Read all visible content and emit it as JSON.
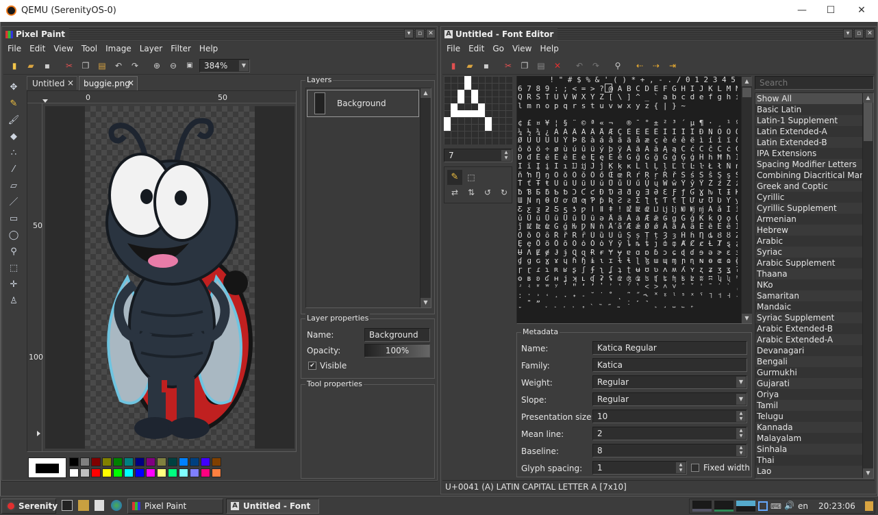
{
  "qemu": {
    "title": "QEMU (SerenityOS-0)",
    "minimize": "—",
    "maximize": "☐",
    "close": "✕"
  },
  "pixel_paint": {
    "title": "Pixel Paint",
    "menu": [
      "File",
      "Edit",
      "View",
      "Tool",
      "Image",
      "Layer",
      "Filter",
      "Help"
    ],
    "zoom": "384%",
    "tabs": [
      {
        "label": "Untitled",
        "close": "×"
      },
      {
        "label": "buggie.png",
        "close": "×"
      }
    ],
    "ruler_top": [
      "0",
      "50"
    ],
    "ruler_left": [
      "50",
      "100"
    ],
    "tool_names": [
      "move",
      "pen",
      "brush",
      "bucket",
      "spray",
      "picker",
      "erase",
      "line",
      "rect",
      "ellipse",
      "zoom",
      "rect-select",
      "guide",
      "clone"
    ],
    "tool_icons": [
      "✥",
      "✎",
      "🖌",
      "◆",
      "∴",
      "⁄",
      "▱",
      "／",
      "▭",
      "◯",
      "⚲",
      "⬚",
      "✛",
      "♙"
    ],
    "layers": {
      "title": "Layers",
      "items": [
        "Background"
      ]
    },
    "layer_properties": {
      "title": "Layer properties",
      "name_label": "Name:",
      "name_value": "Background",
      "opacity_label": "Opacity:",
      "opacity_value": "100%",
      "visible_label": "Visible",
      "visible_check": "✔"
    },
    "tool_properties": {
      "title": "Tool properties"
    },
    "palette": {
      "row1": [
        "#000000",
        "#808080",
        "#800000",
        "#808000",
        "#008000",
        "#008080",
        "#000080",
        "#800080",
        "#80803f",
        "#004040",
        "#0080ff",
        "#004080",
        "#4000ff",
        "#804000"
      ],
      "row2": [
        "#ffffff",
        "#c0c0c0",
        "#ff0000",
        "#ffff00",
        "#00ff00",
        "#00ffff",
        "#0000ff",
        "#ff00ff",
        "#ffff80",
        "#00ff80",
        "#80ffff",
        "#8080ff",
        "#ff0080",
        "#ff8040"
      ],
      "primary": "#000000",
      "secondary": "#ffffff"
    }
  },
  "font_editor": {
    "title": "Untitled - Font Editor",
    "menu": [
      "File",
      "Edit",
      "Go",
      "View",
      "Help"
    ],
    "glyph_width": "7",
    "charset_rows": [
      "       ! \" # $ % & ' ( ) * + , - . / 0 1 2 3 4 5",
      "6 7 8 9 : ; < = > ? @ A B C D E F G H I J K L M N O P",
      "Q R S T U V W X Y Z [ \\ ] ^ _ ` a b c d e f g h i j k",
      "l m n o p q r s t u v w x y z { | } ~",
      "",
      "¢ £ ¤ ¥ ¦ § ¨ © ª « ¬   ® ¯ ° ± ² ³ ´ µ ¶ · ¸ ¹ º »",
      "¼ ½ ¾ ¿ À Á Â Ã Ä Å Æ Ç È É Ê Ë Ì Í Î Ï Ð Ñ Ò Ó Ô Õ Ö ×",
      "Ø Ù Ú Û Ü Ý Þ ß à á â ã ä å æ ç è é ê ë ì í î ï ð ñ ò ó",
      "ô õ ö ÷ ø ù ú û ü ý þ ÿ Ā ā Ă ă Ą ą Ć ć Ĉ ĉ Ċ ċ Č č Ď ď",
      "Đ đ Ē ē Ĕ ĕ Ė ė Ę ę Ě ě Ĝ ĝ Ğ ğ Ġ ġ Ģ ģ Ĥ ĥ Ħ ħ Ĩ ĩ Ī ī",
      "Ĭ ĭ Į į İ ı Ĳ ĳ Ĵ ĵ Ķ ķ ĸ Ĺ ĺ Ļ ļ Ľ ľ Ŀ ŀ Ł ł Ń ń Ņ ņ Ň",
      "ň ŉ Ŋ ŋ Ō ō Ŏ ŏ Ő ő Œ œ Ŕ ŕ Ŗ ŗ Ř ř Ś ś Ŝ ŝ Ş ş Š š Ţ ţ",
      "Ť ť Ŧ ŧ Ũ ũ Ū ū Ŭ ŭ Ů ů Ű ű Ų ų Ŵ ŵ Ŷ ŷ Ÿ Ź ź Ż ż Ž ž ſ",
      "ƀ Ɓ Ƃ ƃ Ƅ ƅ Ɔ Ƈ ƈ Ɖ Ɗ Ƌ ƌ ƍ Ǝ Ə Ɛ Ƒ ƒ Ɠ Ɣ ƕ Ɩ Ɨ Ƙ ƙ ƚ ƛ",
      "Ɯ Ɲ ƞ Ɵ Ơ ơ Ƣ ƣ Ƥ ƥ Ʀ Ƨ ƨ Ʃ ƪ ƫ Ƭ ƭ Ʈ Ư ư Ʊ Ʋ Ƴ ƴ Ƶ ƶ Ʒ",
      "Ƹ ƹ ƺ ƻ Ƽ ƽ ƾ ƿ ǀ ǁ ǂ ǃ Ǆ ǅ ǆ Ǉ ǈ ǉ Ǌ ǋ ǌ Ǎ ǎ Ǐ ǐ Ǒ ǒ Ǔ",
      "ǔ Ǖ ǖ Ǘ ǘ Ǚ ǚ Ǜ ǜ ǝ Ǟ ǟ Ǡ ǡ Ǣ ǣ Ǥ ǥ Ǧ ǧ Ǩ ǩ Ǫ ǫ Ǭ ǭ Ǯ ǯ",
      "ǰ Ǳ ǲ ǳ Ǵ ǵ Ƕ Ƿ Ǹ ǹ Ǻ ǻ Ǽ ǽ Ǿ ǿ Ȁ ȁ Ȃ ȃ Ȅ ȅ Ȇ ȇ Ȉ ȉ Ȋ ȋ",
      "Ȍ ȍ Ȏ ȏ Ȑ ȑ Ȓ ȓ Ȕ ȕ Ȗ ȗ Ș ș Ț ț Ȝ ȝ Ȟ ȟ Ƞ ȡ Ȣ ȣ Ȥ ȥ Ȧ ȧ",
      "Ȩ ȩ Ȫ ȫ Ȭ ȭ Ȯ ȯ Ȱ ȱ Ȳ ȳ ȴ ȵ ȶ ȷ ȸ ȹ Ⱥ Ȼ ȼ Ƚ Ⱦ ȿ ɀ Ɂ ɂ Ƀ",
      "Ʉ Ʌ Ɇ ɇ Ɉ ɉ Ɋ ɋ Ɍ ɍ Ɏ ɏ ɐ ɑ ɒ ɓ ɔ ɕ ɖ ɗ ɘ ə ɚ ɛ ɜ ɝ ɞ ɟ",
      "ɠ ɡ ɢ ɣ ɤ ɥ ɦ ɧ ɨ ɩ ɪ ɫ ɬ ɭ ɮ ɯ ɰ ɱ ɲ ɳ ɴ ɵ ɶ ɷ ɸ ɹ ɺ ɻ",
      "ɼ ɽ ɾ ɿ ʀ ʁ ʂ ʃ ʄ ʅ ʆ ʇ ʈ ʉ ʊ ʋ ʌ ʍ ʎ ʏ ʐ ʑ ʒ ʓ ʔ ʕ ʖ ʗ",
      "ʘ ʙ ʚ ʛ ʜ ʝ ʞ ʟ ʠ ʡ ʢ ʣ ʤ ʥ ʦ ʧ ʨ ʩ ʪ ʫ ʬ ʭ ʮ ʯ ʰ ʱ ʲ ʳ",
      "ʴ ʵ ʶ ʷ ʸ ʹ ʺ ʻ ʼ ʽ ʾ ʿ ˀ ˁ ˂ ˃ ˄ ˅ ˆ ˇ ˈ ˉ ˊ ˋ ˌ ˍ ˎ ˏ",
      "ː ˑ ˒ ˓ ˔ ˕ ˖ ˗ ˘ ˙ ˚ ˛ ˜ ˝ ˞ ˟ ˠ ˡ ˢ ˣ ˤ ˥ ˦ ˧ ˨ ˩ ˪ ˫",
      "ˬ ˭ ˮ ˯ ˰ ˱ ˲ ˳ ˴ ˵ ˶ ˷ ˸ ˹ ˺ ˻ ˼ ˽ ˾ ˿",
      "",
      "",
      "˜ _ _ ~ - — ⁄ ⁄        ¸"
    ],
    "metadata": {
      "title": "Metadata",
      "name_label": "Name:",
      "name_value": "Katica Regular",
      "family_label": "Family:",
      "family_value": "Katica",
      "weight_label": "Weight:",
      "weight_value": "Regular",
      "slope_label": "Slope:",
      "slope_value": "Regular",
      "presentation_label": "Presentation size:",
      "presentation_value": "10",
      "mean_label": "Mean line:",
      "mean_value": "2",
      "baseline_label": "Baseline:",
      "baseline_value": "8",
      "spacing_label": "Glyph spacing:",
      "spacing_value": "1",
      "fixed_label": "Fixed width"
    },
    "search_placeholder": "Search",
    "blocks": [
      "Show All",
      "Basic Latin",
      "Latin-1 Supplement",
      "Latin Extended-A",
      "Latin Extended-B",
      "IPA Extensions",
      "Spacing Modifier Letters",
      "Combining Diacritical Marks",
      "Greek and Coptic",
      "Cyrillic",
      "Cyrillic Supplement",
      "Armenian",
      "Hebrew",
      "Arabic",
      "Syriac",
      "Arabic Supplement",
      "Thaana",
      "NKo",
      "Samaritan",
      "Mandaic",
      "Syriac Supplement",
      "Arabic Extended-B",
      "Arabic Extended-A",
      "Devanagari",
      "Bengali",
      "Gurmukhi",
      "Gujarati",
      "Oriya",
      "Tamil",
      "Telugu",
      "Kannada",
      "Malayalam",
      "Sinhala",
      "Thai",
      "Lao"
    ],
    "status": "U+0041 (A) LATIN CAPITAL LETTER A [7x10]"
  },
  "taskbar": {
    "start": "Serenity",
    "tasks": [
      "Pixel Paint",
      "Untitled - Font ..."
    ],
    "lang": "en",
    "clock": "20:23:06"
  }
}
